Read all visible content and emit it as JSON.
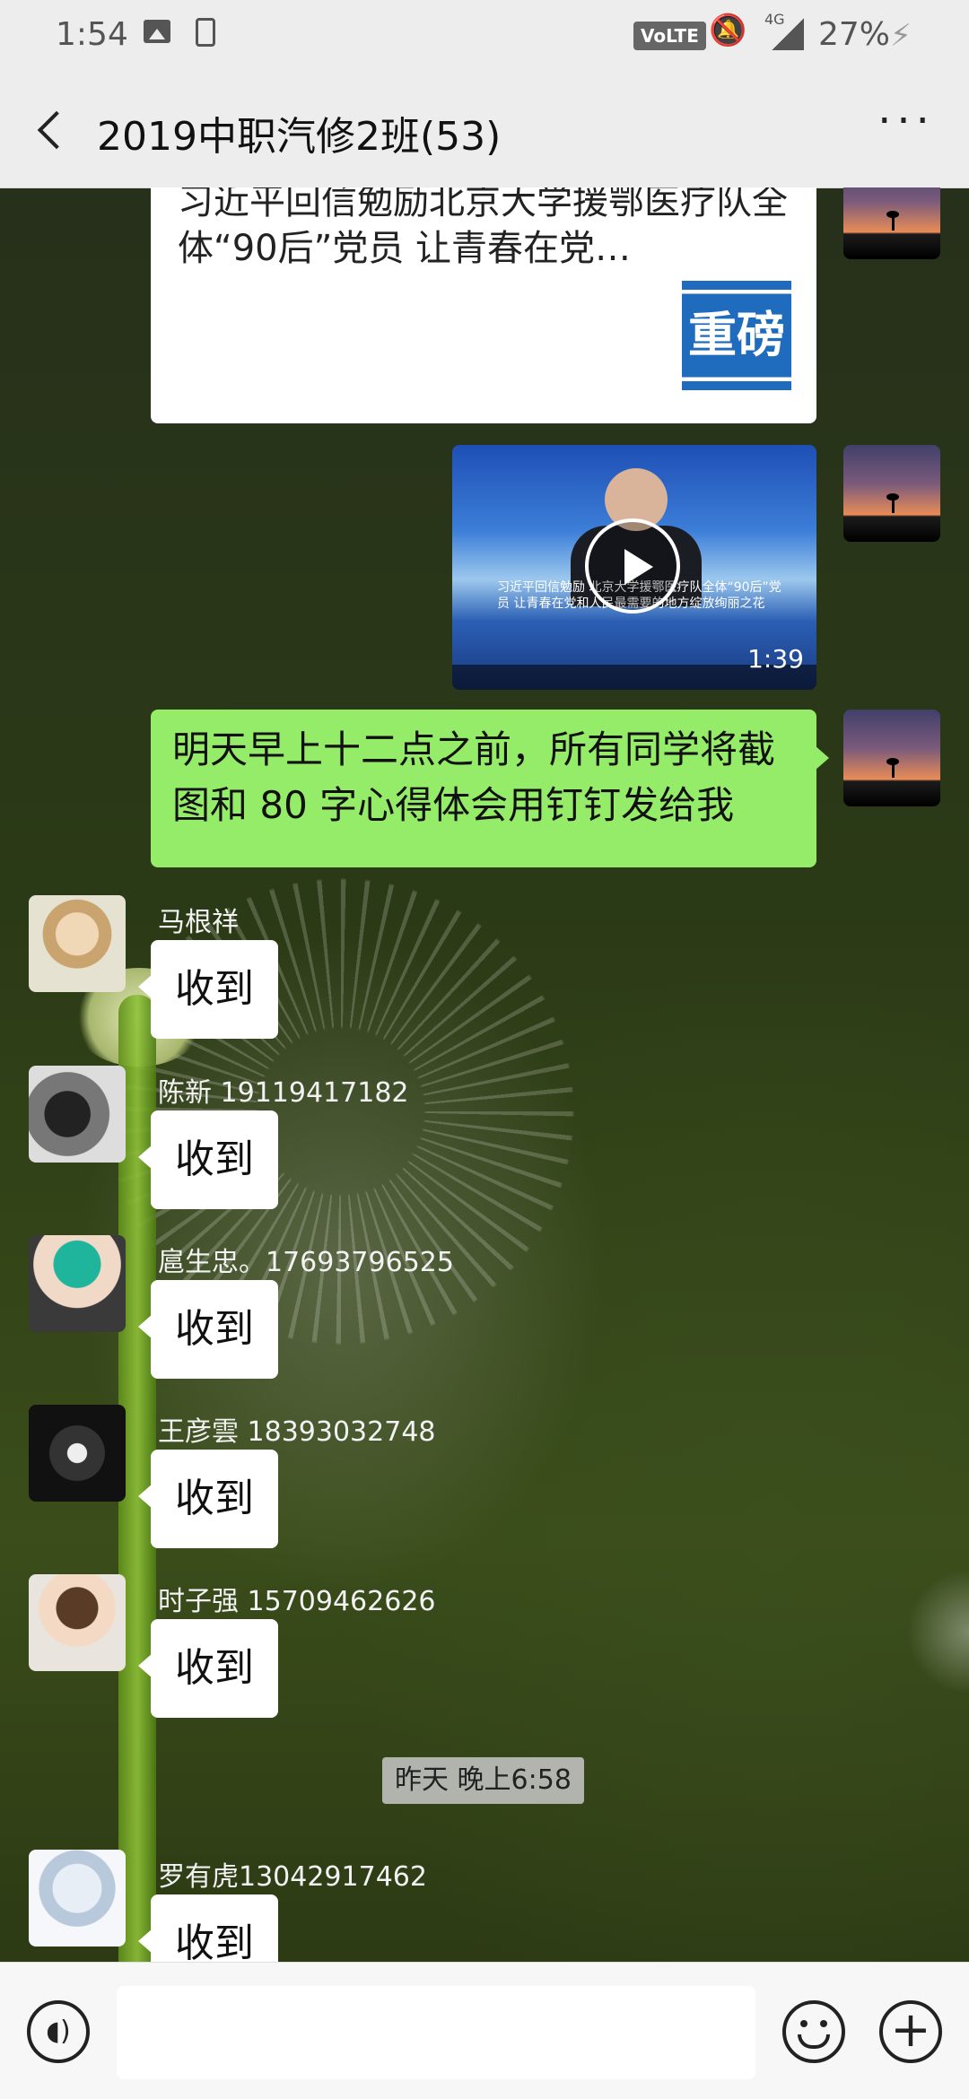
{
  "status_bar": {
    "time": "1:54",
    "volte": "VoLTE",
    "network": "4G",
    "battery": "27%"
  },
  "header": {
    "title": "2019中职汽修2班(53)",
    "more": "···"
  },
  "messages": {
    "link_card": {
      "title": "习近平回信勉励北京大学援鄂医疗队全体“90后”党员 让青春在党…",
      "thumb_text": "重磅"
    },
    "video": {
      "caption": "习近平回信勉励 北京大学援鄂医疗队全体“90后”党员 让青春在党和人民最需要的地方绽放绚丽之花",
      "duration": "1:39"
    },
    "my_text": "明天早上十二点之前，所有同学将截图和 80 字心得体会用钉钉发给我",
    "replies": [
      {
        "name": "马根祥",
        "text": "收到"
      },
      {
        "name": "陈新  19119417182",
        "text": "收到"
      },
      {
        "name": "扈生忠。17693796525",
        "text": "收到"
      },
      {
        "name": "王彦雲  18393032748",
        "text": "收到"
      },
      {
        "name": "时子强   15709462626",
        "text": "收到"
      }
    ],
    "time_divider": "昨天 晚上6:58",
    "last_reply": {
      "name": "罗有虎13042917462",
      "text": "收到"
    }
  },
  "input": {
    "value": "",
    "voice_icon": "voice-icon",
    "emoji_icon": "emoji-icon",
    "plus": "+"
  }
}
